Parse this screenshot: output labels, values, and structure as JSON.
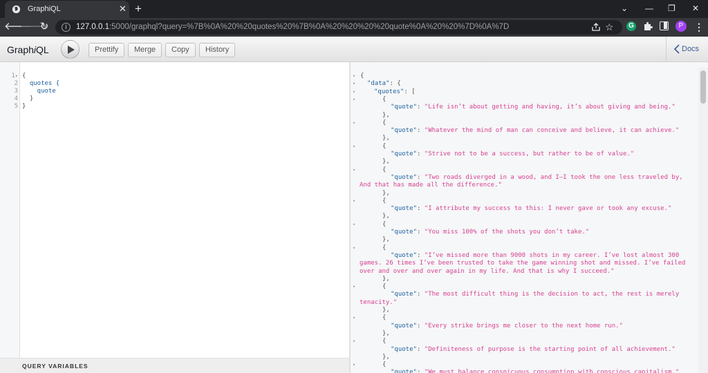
{
  "browser": {
    "tab_title": "GraphiQL",
    "tab_close": "✕",
    "new_tab": "+",
    "window_controls": [
      "⌄",
      "—",
      "❐",
      "✕"
    ],
    "url_host": "127.0.0.1",
    "url_rest": ":5000/graphql?query=%7B%0A%20%20quotes%20%7B%0A%20%20%20%20quote%0A%20%20%7D%0A%7D",
    "profile_initial": "P",
    "ext_g": "G"
  },
  "graphiql": {
    "title_prefix": "Graph",
    "title_italic": "i",
    "title_suffix": "QL",
    "buttons": {
      "prettify": "Prettify",
      "merge": "Merge",
      "copy": "Copy",
      "history": "History"
    },
    "docs": "Docs",
    "query_variables": "QUERY VARIABLES"
  },
  "query": {
    "line_numbers": [
      "1",
      "2",
      "3",
      "4",
      "5"
    ],
    "lines": [
      "{",
      "  quotes {",
      "    quote",
      "  }",
      "}"
    ]
  },
  "result": {
    "data_key": "\"data\"",
    "quotes_key": "\"quotes\"",
    "quote_key": "\"quote\"",
    "quotes": [
      [
        "\"Life isn’t about getting and having, it’s about giving and being.\""
      ],
      [
        "\"Whatever the mind of man can conceive and believe, it can achieve.\""
      ],
      [
        "\"Strive not to be a success, but rather to be of value.\""
      ],
      [
        "\"Two roads diverged in a wood, and I—I took the one less traveled by,",
        "And that has made all the difference.\""
      ],
      [
        "\"I attribute my success to this: I never gave or took any excuse.\""
      ],
      [
        "\"You miss 100% of the shots you don’t take.\""
      ],
      [
        "\"I’ve missed more than 9000 shots in my career. I’ve lost almost 300",
        "games. 26 times I’ve been trusted to take the game winning shot and missed. I’ve failed",
        "over and over and over again in my life. And that is why I succeed.\""
      ],
      [
        "\"The most difficult thing is the decision to act, the rest is merely",
        "tenacity.\""
      ],
      [
        "\"Every strike brings me closer to the next home run.\""
      ],
      [
        "\"Definiteness of purpose is the starting point of all achievement.\""
      ],
      [
        "\"We must balance conspicuous consumption with conscious capitalism.\""
      ]
    ]
  }
}
